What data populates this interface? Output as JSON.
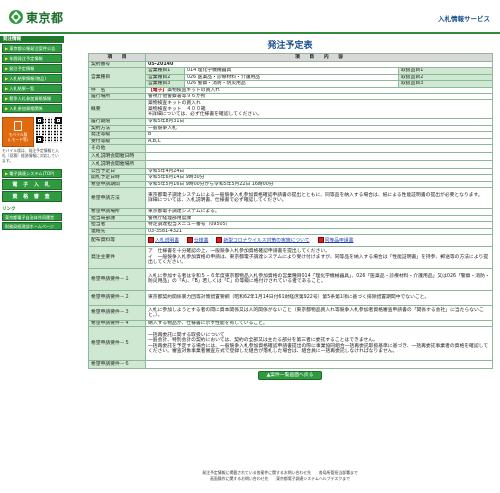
{
  "header": {
    "logo_text": "東京都",
    "service_name": "入札情報サービス"
  },
  "sidebar": {
    "heading": "発注情報",
    "items": [
      "東京都公報発注案件公告",
      "年間発注予定情報",
      "発注予定情報",
      "入札結果情報(物品)",
      "入札結果一覧",
      "競争入札参加資格情報",
      "入札参加資格関係"
    ],
    "mobile_button": "モバイル版\n(i-モード等)",
    "mobile_note": "モバイル版は、発注予定情報と入札（見積）経過情報に対応しています。",
    "system_heading": "電子調達システム(TOP)",
    "big_items": [
      "電 子 入 札",
      "資 格 審 査"
    ],
    "links_heading": "リンク",
    "links": [
      "東京都電子自治体共同運営",
      "財務局経理部ホームページ"
    ]
  },
  "main": {
    "title": "発注予定表",
    "col_item": "項　　目",
    "col_content": "項　　目　　内　　容",
    "contract_no_label": "契約番号",
    "contract_no": "05-20140",
    "business_type_label": "営業種目",
    "business_items": [
      {
        "label": "営業種目1",
        "value": "014 理化学機械器具",
        "grade_label": "取扱品目1"
      },
      {
        "label": "営業種目2",
        "value": "026 医薬品・診療材料・介護用品",
        "grade_label": "取扱品目2"
      },
      {
        "label": "営業種目3",
        "value": "026 警察・消防・防災用品",
        "grade_label": "取扱品目3"
      }
    ],
    "subject_label": "件　名",
    "subject_tag": "【電子】",
    "subject": "薬物検査キットの買入れ",
    "location_label": "履行場所",
    "location": "警視庁他警察署等９６か所",
    "summary_label": "概要",
    "summary": "薬物検査キットの買入れ\n薬物検査キット　４００箱\n※詳細については、必ず仕様書を確認してください。",
    "rows": [
      {
        "label": "履行期限",
        "value": "令和5年8月31日"
      },
      {
        "label": "契約方法",
        "value": "一般競争入札"
      },
      {
        "label": "発注等級",
        "value": "B"
      },
      {
        "label": "受付等級",
        "value": "A,B,C"
      },
      {
        "label": "その他",
        "value": ""
      },
      {
        "label": "入札説明会開催日時",
        "value": ""
      },
      {
        "label": "入札説明会開催場所",
        "value": ""
      },
      {
        "label": "公告予定日",
        "value": "令和5年4月24日"
      },
      {
        "label": "開札予定日時",
        "value": "令和5年6月14日 9時30分"
      },
      {
        "label": "希望申請期間",
        "value": "令和5年5月16日 9時00分から令和5年5月22日 16時00分"
      }
    ],
    "request_method_label": "希望申請方法",
    "request_method": "東京都電子調達システムによる一般競争入札参加資格確認申請書の提出とともに、同等品を納入する場合は、紙による性能証明書の提出が必要となります。\n詳細については、入札説明書、仕様書で必ず確認してください。",
    "request_place_label": "希望申請場所",
    "request_place": "東京都電子調達システムによる。",
    "dept_label": "担当局部課",
    "dept": "警視庁経理部用度課",
    "person_label": "担当者",
    "person": "特定調達担当メニュー番号（09505）",
    "contact_label": "連絡先",
    "contact": "03-3581-4321",
    "docs_label": "配布資料等",
    "docs": [
      "入札説明書",
      "仕様書",
      "新型コロナウイルス対策の実施について",
      "同等品申請書"
    ],
    "notice_label": "発注主要件",
    "notice": "ア　仕様書を十分確認の上、一般競争入札参加資格確認申請書を提出してください。\nイ　一般競争入札参加資格の申請は、東京都電子調達システムにより受け付けますが、同等品を納入する場合は「性能証明書」を持参、郵送等の方法により提出してください。",
    "req_items": [
      {
        "label": "希望申請要件－１",
        "value": "入札に参加する者は令和５・６年度東京都物品入札参加資格の営業種目014「理化学機械器具」、026「医薬品・診療材料・介護用品」又は026「警察・消防・防災用品」の「A」、「B」若しくは「C」の等級に格付けされている者であること。"
      },
      {
        "label": "希望申請要件－２",
        "value": "東京都契約関係暴力団等対策措置要綱（昭和62年1月14日付61財経庶第922号）第5条第1項に基づく排除措置期間中でないこと。"
      },
      {
        "label": "希望申請要件－３",
        "value": "入札に参加しようとする者の間に資本関係又は人的関係がないこと（東京都物品買入れ等競争入札参加者資格審査申請書の「関係する会社」に当たらないこと。）。"
      },
      {
        "label": "希望申請要件－４",
        "value": "納入する物品が、仕様書に示す性能を有していること。"
      },
      {
        "label": "希望申請要件－５",
        "value": "一括再委託に関する取扱いについて\n一般会計、特別会計の契約においては、契約の全部又は主たる部分を第三者に委託することはできません。\n一括再委託を予定する場合には、一般競争入札参加資格確認申請書提出の際に事業協同組合一括再委託取扱基準に基づき、一括再委託事業者の資格を確認してください。審査対象事業者審査方式で登録した組合が落札した場合は、組合員に一括再委託しなければなりません。"
      },
      {
        "label": "希望申請要件－６",
        "value": ""
      }
    ],
    "back_button": "▲案件一覧画面へ戻る"
  },
  "footer": {
    "line1": "発注予定情報に掲載されている各案件に関するお問い合わせ先　　各局所管担当部署まで",
    "line2": "画面操作に関するお問い合わせ先　　東京都電子調達システムヘルプデスクまで"
  },
  "colors": {
    "brand_green": "#2f9a40",
    "label_bg": "#cfe8d1",
    "title_blue": "#1a4f8c",
    "warning_red": "#cc1010"
  }
}
